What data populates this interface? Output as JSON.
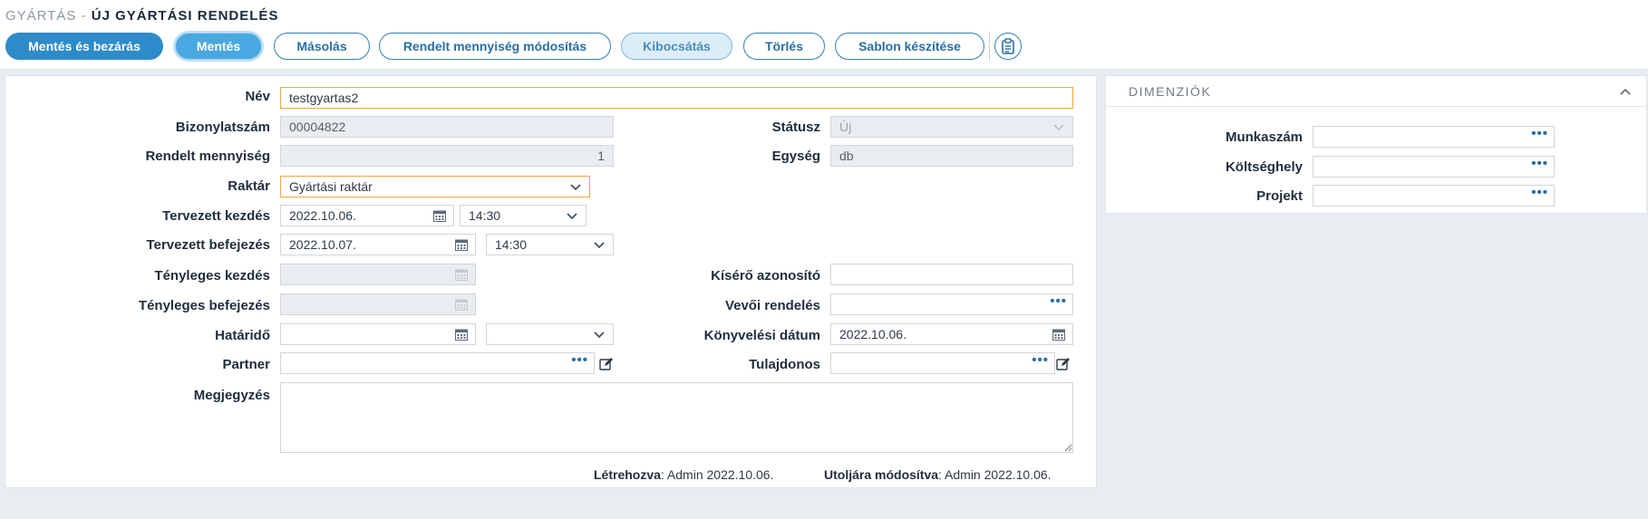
{
  "breadcrumb": {
    "section": "GYÁRTÁS -",
    "title": "ÚJ GYÁRTÁSI RENDELÉS"
  },
  "toolbar": {
    "save_close": "Mentés és bezárás",
    "save": "Mentés",
    "copy": "Másolás",
    "modify_qty": "Rendelt mennyiség módosítás",
    "issue": "Kibocsátás",
    "delete": "Törlés",
    "template": "Sablon készítése",
    "extra_icon": "clipboard-icon"
  },
  "form": {
    "name": {
      "label": "Név",
      "value": "testgyartas2"
    },
    "doc_number": {
      "label": "Bizonylatszám",
      "value": "00004822"
    },
    "status": {
      "label": "Státusz",
      "value": "Új"
    },
    "ordered_qty": {
      "label": "Rendelt mennyiség",
      "value": "1"
    },
    "unit": {
      "label": "Egység",
      "value": "db"
    },
    "warehouse": {
      "label": "Raktár",
      "value": "Gyártási raktár"
    },
    "planned_start": {
      "label": "Tervezett kezdés",
      "date": "2022.10.06.",
      "time": "14:30"
    },
    "planned_end": {
      "label": "Tervezett befejezés",
      "date": "2022.10.07.",
      "time": "14:30"
    },
    "actual_start": {
      "label": "Tényleges kezdés",
      "date": ""
    },
    "actual_end": {
      "label": "Tényleges befejezés",
      "date": ""
    },
    "tracking_id": {
      "label": "Kísérő azonosító",
      "value": ""
    },
    "customer_order": {
      "label": "Vevői rendelés",
      "value": ""
    },
    "deadline": {
      "label": "Határidő",
      "date": "",
      "time": ""
    },
    "posting_date": {
      "label": "Könyvelési dátum",
      "value": "2022.10.06."
    },
    "partner": {
      "label": "Partner",
      "value": ""
    },
    "owner": {
      "label": "Tulajdonos",
      "value": ""
    },
    "note": {
      "label": "Megjegyzés",
      "value": ""
    }
  },
  "footer": {
    "created_label": "Létrehozva",
    "created_value": ": Admin 2022.10.06.",
    "modified_label": "Utoljára módosítva",
    "modified_value": ": Admin 2022.10.06."
  },
  "dimensions": {
    "title": "DIMENZIÓK",
    "work_number": {
      "label": "Munkaszám",
      "value": ""
    },
    "cost_center": {
      "label": "Költséghely",
      "value": ""
    },
    "project": {
      "label": "Projekt",
      "value": ""
    }
  },
  "colors": {
    "primary": "#2e8bc9",
    "focus_border": "#f0a93b",
    "background": "#e8edf1"
  }
}
